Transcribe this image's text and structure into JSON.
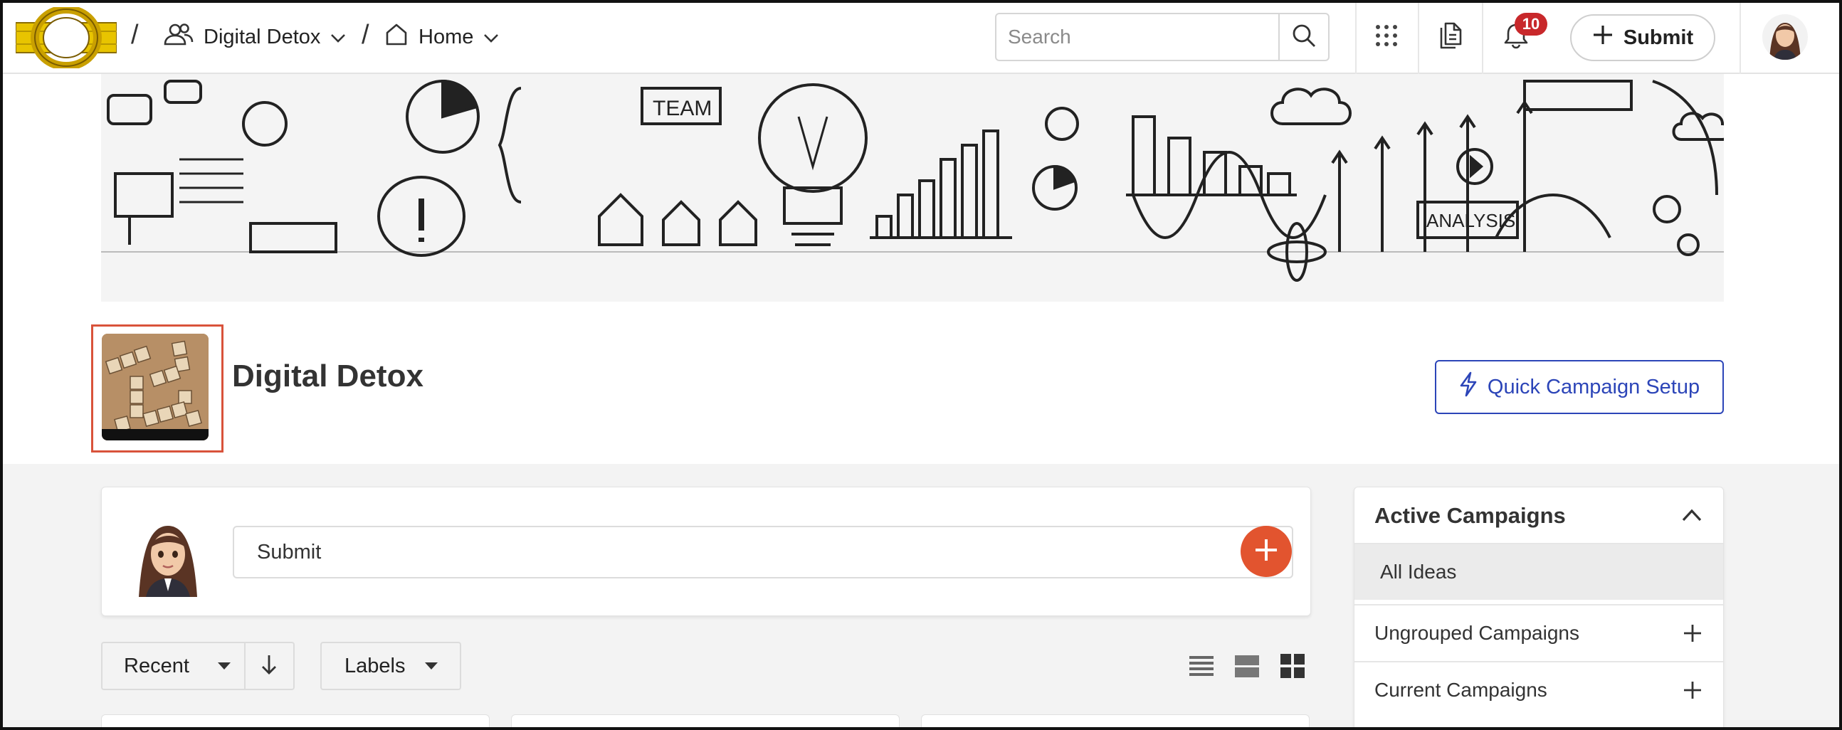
{
  "header": {
    "breadcrumb": [
      {
        "label": "Digital Detox",
        "icon": "group-icon"
      },
      {
        "label": "Home",
        "icon": "home-icon"
      }
    ],
    "separator": "/",
    "search": {
      "placeholder": "Search"
    },
    "notifications_count": "10",
    "submit_label": "Submit"
  },
  "group": {
    "title": "Digital Detox",
    "quick_setup_label": "Quick Campaign Setup"
  },
  "feed": {
    "submit_placeholder": "Submit",
    "sort_label": "Recent",
    "labels_label": "Labels"
  },
  "sidebar": {
    "title": "Active Campaigns",
    "items": [
      {
        "label": "All Ideas",
        "active": true
      },
      {
        "label": "Ungrouped Campaigns"
      },
      {
        "label": "Current Campaigns"
      }
    ]
  },
  "colors": {
    "accent": "#e2542f",
    "link_blue": "#2c45b8",
    "badge_red": "#c8282b",
    "selection_outline": "#d9533b"
  }
}
